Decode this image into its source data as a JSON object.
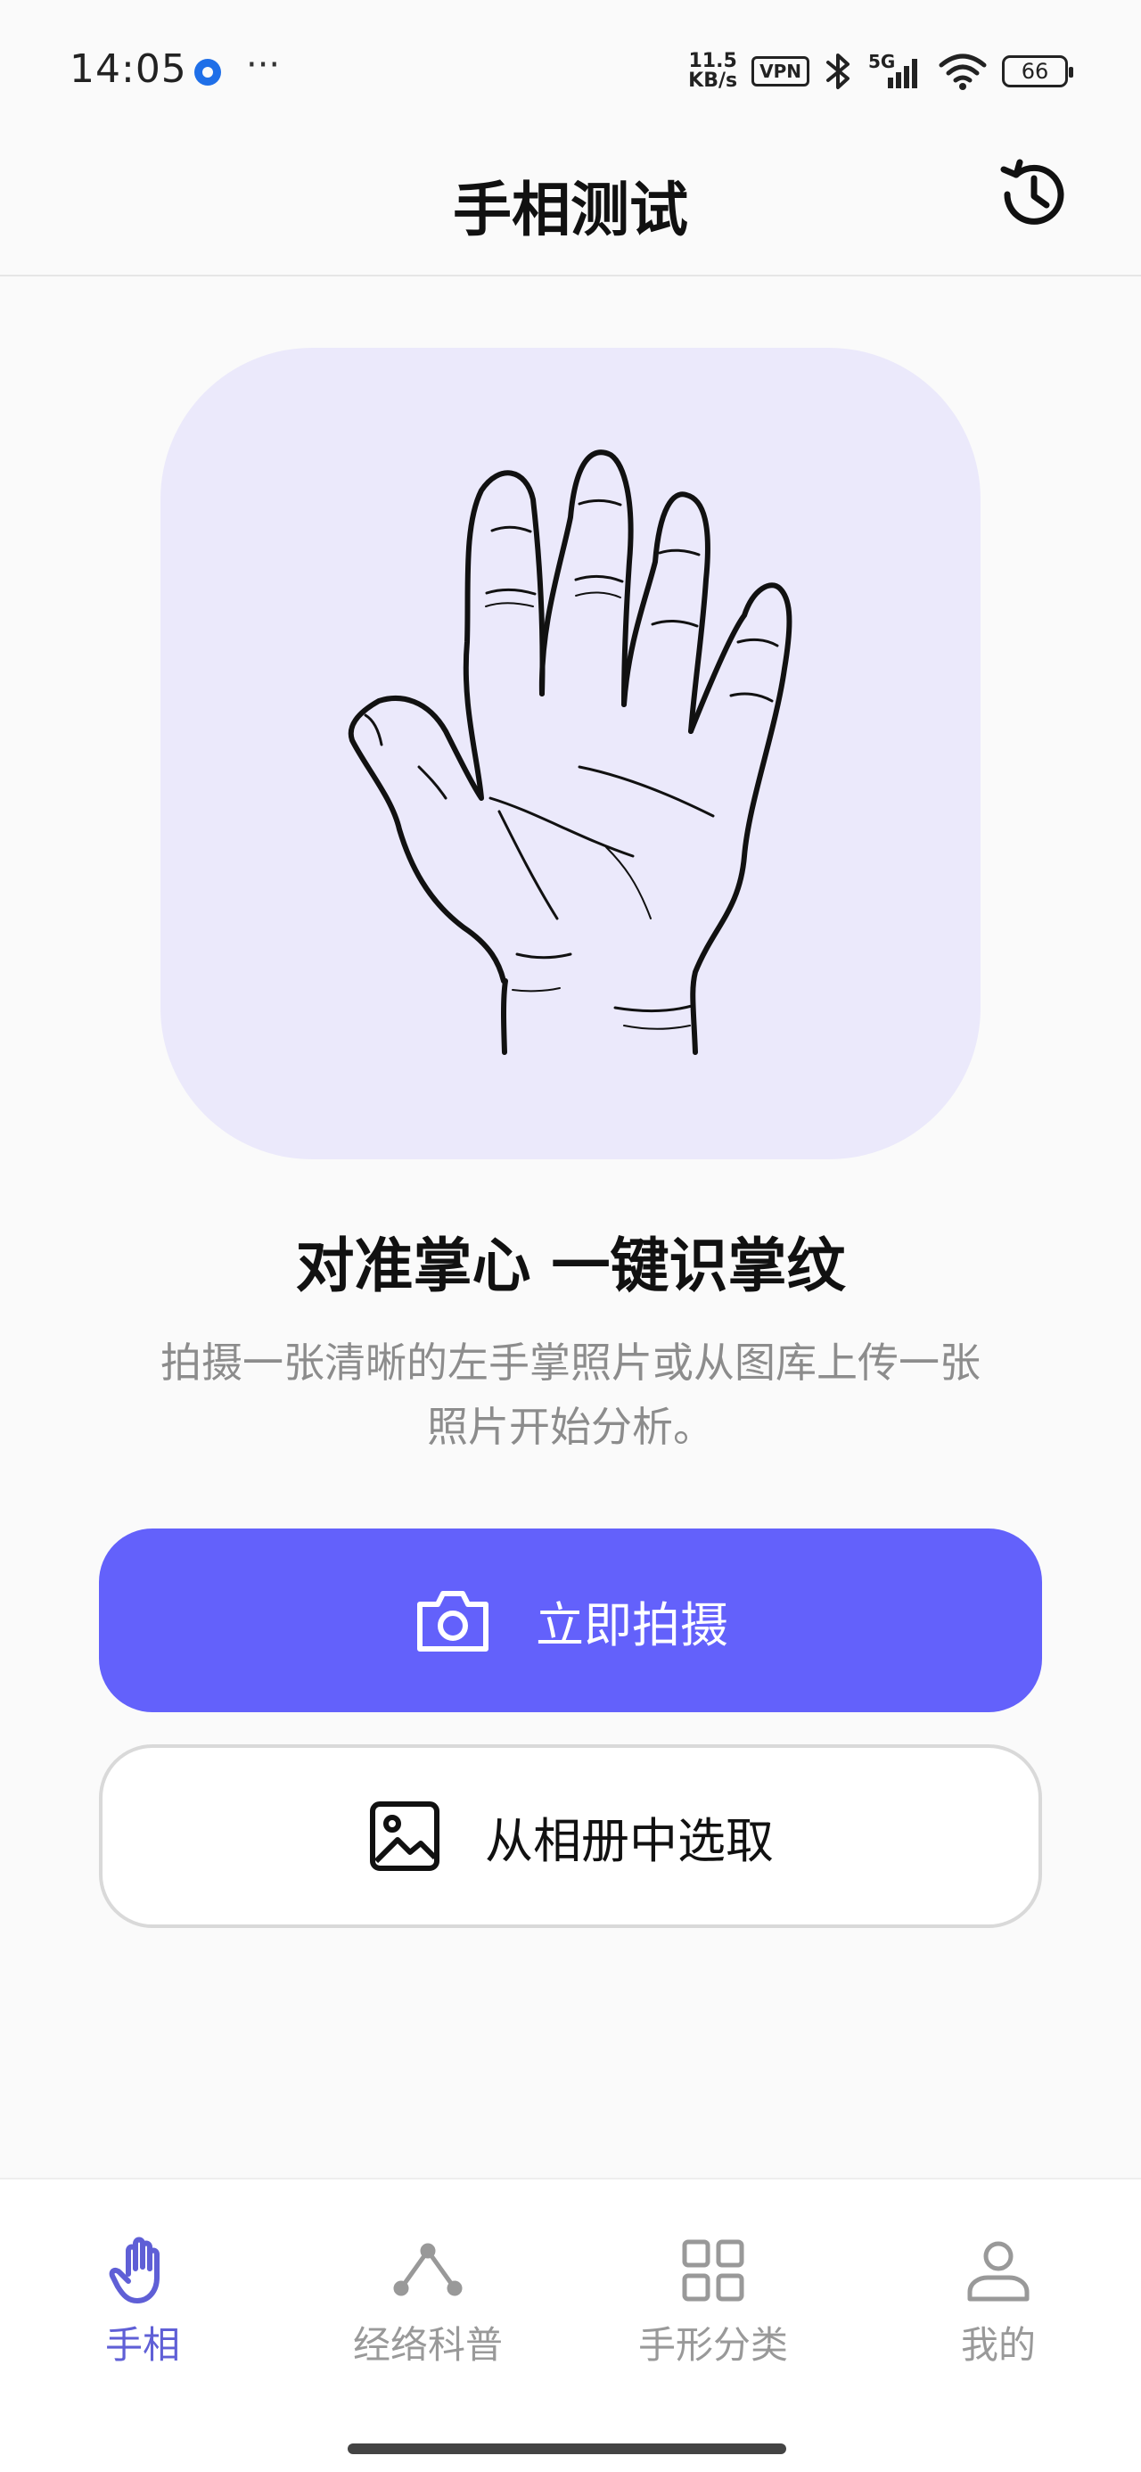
{
  "status_bar": {
    "time": "14:05",
    "net_speed_value": "11.5",
    "net_speed_unit": "KB/s",
    "vpn": "VPN",
    "network": "5G",
    "battery": "66"
  },
  "header": {
    "title": "手相测试",
    "history_icon": "history-icon"
  },
  "hero": {
    "illustration": "palm-hand-illustration",
    "headline": "对准掌心 一键识掌纹",
    "description": "拍摄一张清晰的左手掌照片或从图库上传一张照片开始分析。"
  },
  "actions": {
    "capture_label": "立即拍摄",
    "gallery_label": "从相册中选取"
  },
  "bottom_nav": {
    "items": [
      {
        "label": "手相",
        "icon": "hand-icon",
        "active": true
      },
      {
        "label": "经络科普",
        "icon": "meridian-icon",
        "active": false
      },
      {
        "label": "手形分类",
        "icon": "grid-icon",
        "active": false
      },
      {
        "label": "我的",
        "icon": "profile-icon",
        "active": false
      }
    ]
  },
  "colors": {
    "accent": "#6361fb",
    "hero_bg": "#ebe9fb",
    "active_nav": "#5f5fd6",
    "inactive_nav": "#999999"
  }
}
